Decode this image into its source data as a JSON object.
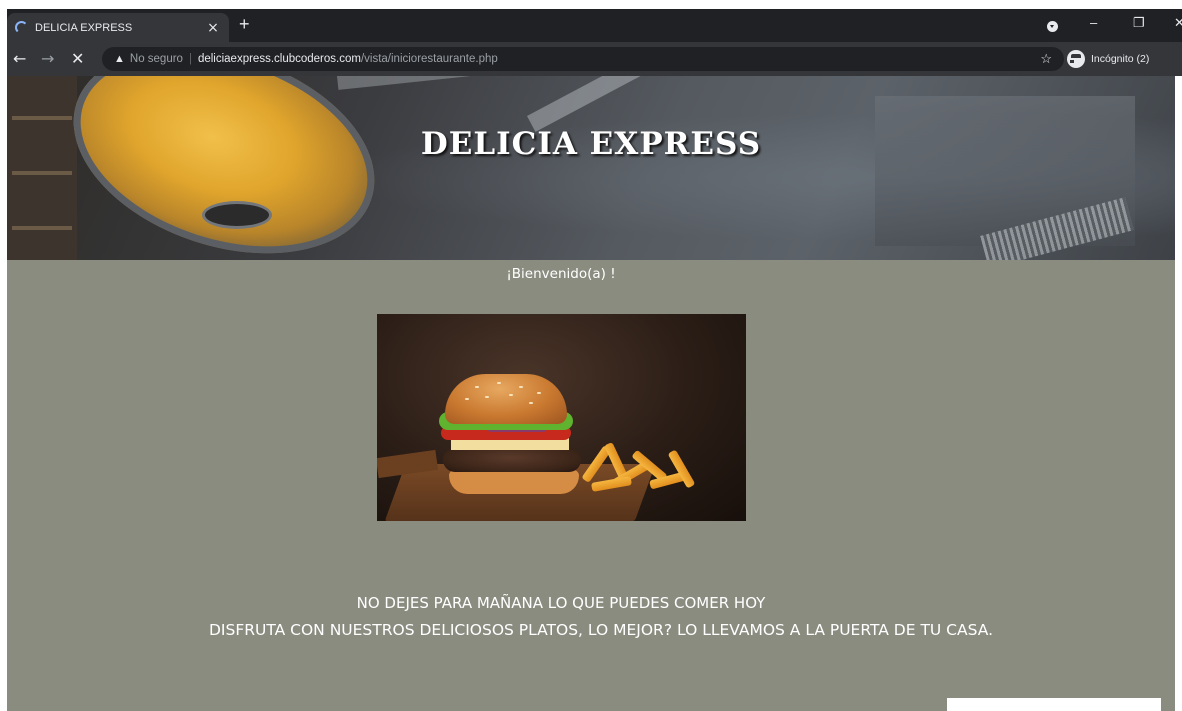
{
  "browser": {
    "tab": {
      "title": "DELICIA EXPRESS",
      "close": "×"
    },
    "new_tab": "+",
    "window": {
      "minimize": "–",
      "restore": "❐",
      "close": "✕"
    },
    "nav": {
      "back": "←",
      "forward": "→",
      "stop": "✕"
    },
    "address": {
      "security_label": "No seguro",
      "separator": "|",
      "host": "deliciaexpress.clubcoderos.com",
      "path": "/vista/iniciorestaurante.php"
    },
    "bookmark_star": "☆",
    "profile_label": "Incógnito (2)"
  },
  "page": {
    "site_title": "DELICIA EXPRESS",
    "welcome": "¡Bienvenido(a) !",
    "tagline_line1": "NO DEJES PARA MAÑANA LO QUE PUEDES COMER HOY",
    "tagline_line2": "DISFRUTA CON NUESTROS DELICIOSOS PLATOS, LO MEJOR? LO LLEVAMOS A LA PUERTA DE TU CASA."
  },
  "colors": {
    "page_background": "#8b8c80",
    "chrome_dark": "#202124",
    "chrome_toolbar": "#35363a",
    "text_light": "#ffffff"
  }
}
